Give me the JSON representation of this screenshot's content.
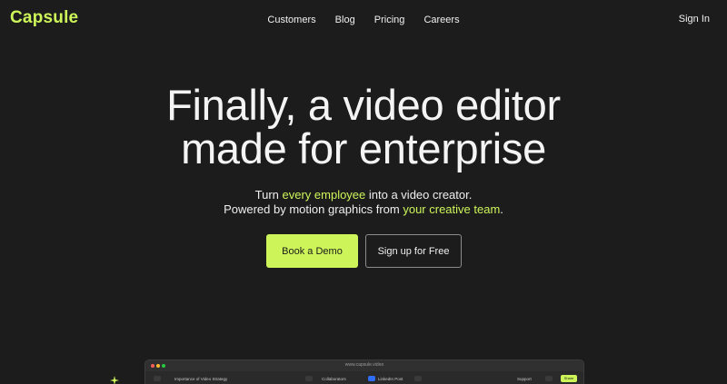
{
  "brand": {
    "name": "Capsule",
    "accent_color": "#cdf55a",
    "background_color": "#1c1c1c"
  },
  "nav": {
    "items": [
      {
        "label": "Customers"
      },
      {
        "label": "Blog"
      },
      {
        "label": "Pricing"
      },
      {
        "label": "Careers"
      }
    ],
    "sign_in": "Sign In"
  },
  "hero": {
    "headline_line1": "Finally, a video editor",
    "headline_line2": "made for enterprise",
    "sub_line1_pre": "Turn ",
    "sub_line1_highlight": "every employee",
    "sub_line1_post": " into a video creator.",
    "sub_line2_pre": "Powered by motion graphics from ",
    "sub_line2_highlight": "your creative team",
    "sub_line2_post": ".",
    "primary_button": "Book a Demo",
    "secondary_button": "Sign up for Free"
  },
  "preview": {
    "url": "www.capsule.video",
    "project_title": "Importance of Video Strategy",
    "tab_collaborators": "Collaborators",
    "tab_linkedin": "LinkedIn Post",
    "support_label": "Support",
    "action_button": "Share",
    "icons": [
      "back-arrow-icon",
      "chat-icon",
      "linkedin-icon",
      "sparkle-icon"
    ]
  }
}
